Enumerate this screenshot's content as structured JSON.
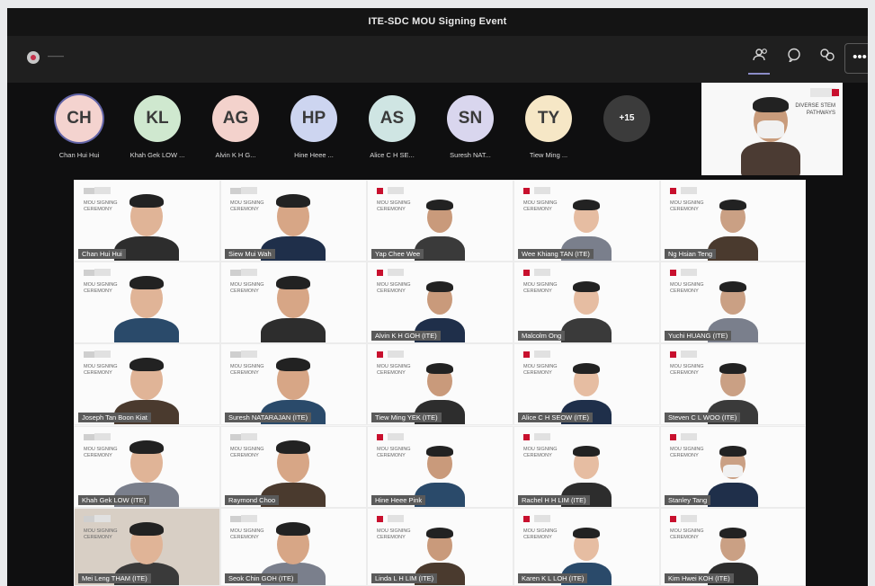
{
  "window": {
    "title": "ITE-SDC MOU Signing Event"
  },
  "toolbar": {
    "recording_time": "——",
    "more_label": "•••"
  },
  "strip": [
    {
      "initials": "CH",
      "name": "Chan Hui Hui",
      "color": "#f4d3cf"
    },
    {
      "initials": "KL",
      "name": "Khah Gek LOW ...",
      "color": "#cfe8cf"
    },
    {
      "initials": "AG",
      "name": "Alvin K H G...",
      "color": "#f3d2cc"
    },
    {
      "initials": "HP",
      "name": "Hine Heee ...",
      "color": "#cdd5f0"
    },
    {
      "initials": "AS",
      "name": "Alice C H SE...",
      "color": "#cfe5e3"
    },
    {
      "initials": "SN",
      "name": "Suresh NAT...",
      "color": "#d9d6ee"
    },
    {
      "initials": "TY",
      "name": "Tiew Ming ...",
      "color": "#f6e7c6"
    },
    {
      "initials": "+15",
      "name": "",
      "color": "#3b3b3b"
    }
  ],
  "selfview": {
    "title_lines": [
      "DIVERSE STEM",
      "PATHWAYS"
    ]
  },
  "tiles": [
    "Chan Hui Hui",
    "Siew Mui Wah",
    "Yap Chee Wee",
    "Wee Khiang TAN (ITE)",
    "Ng Hsian Teng",
    "",
    "",
    "Alvin K H GOH (ITE)",
    "Malcolm Ong",
    "Yuchi HUANG (ITE)",
    "Joseph Tan Boon Kiat",
    "Suresh NATARAJAN (ITE)",
    "Tiew Ming YEK (ITE)",
    "Alice C H SEOW (ITE)",
    "Steven C L WOO (ITE)",
    "Khah Gek LOW (ITE)",
    "Raymond Choo",
    "Hine Heee Pink",
    "Rachel H H LIM (ITE)",
    "Stanley Tang",
    "Mei Leng THAM (ITE)",
    "Seok Chin GOH (ITE)",
    "Linda L H LIM (ITE)",
    "Karen K L LOH (ITE)",
    "Kim Hwei KOH (ITE)"
  ],
  "tile_caption": [
    "MOU SIGNING",
    "CEREMONY"
  ]
}
